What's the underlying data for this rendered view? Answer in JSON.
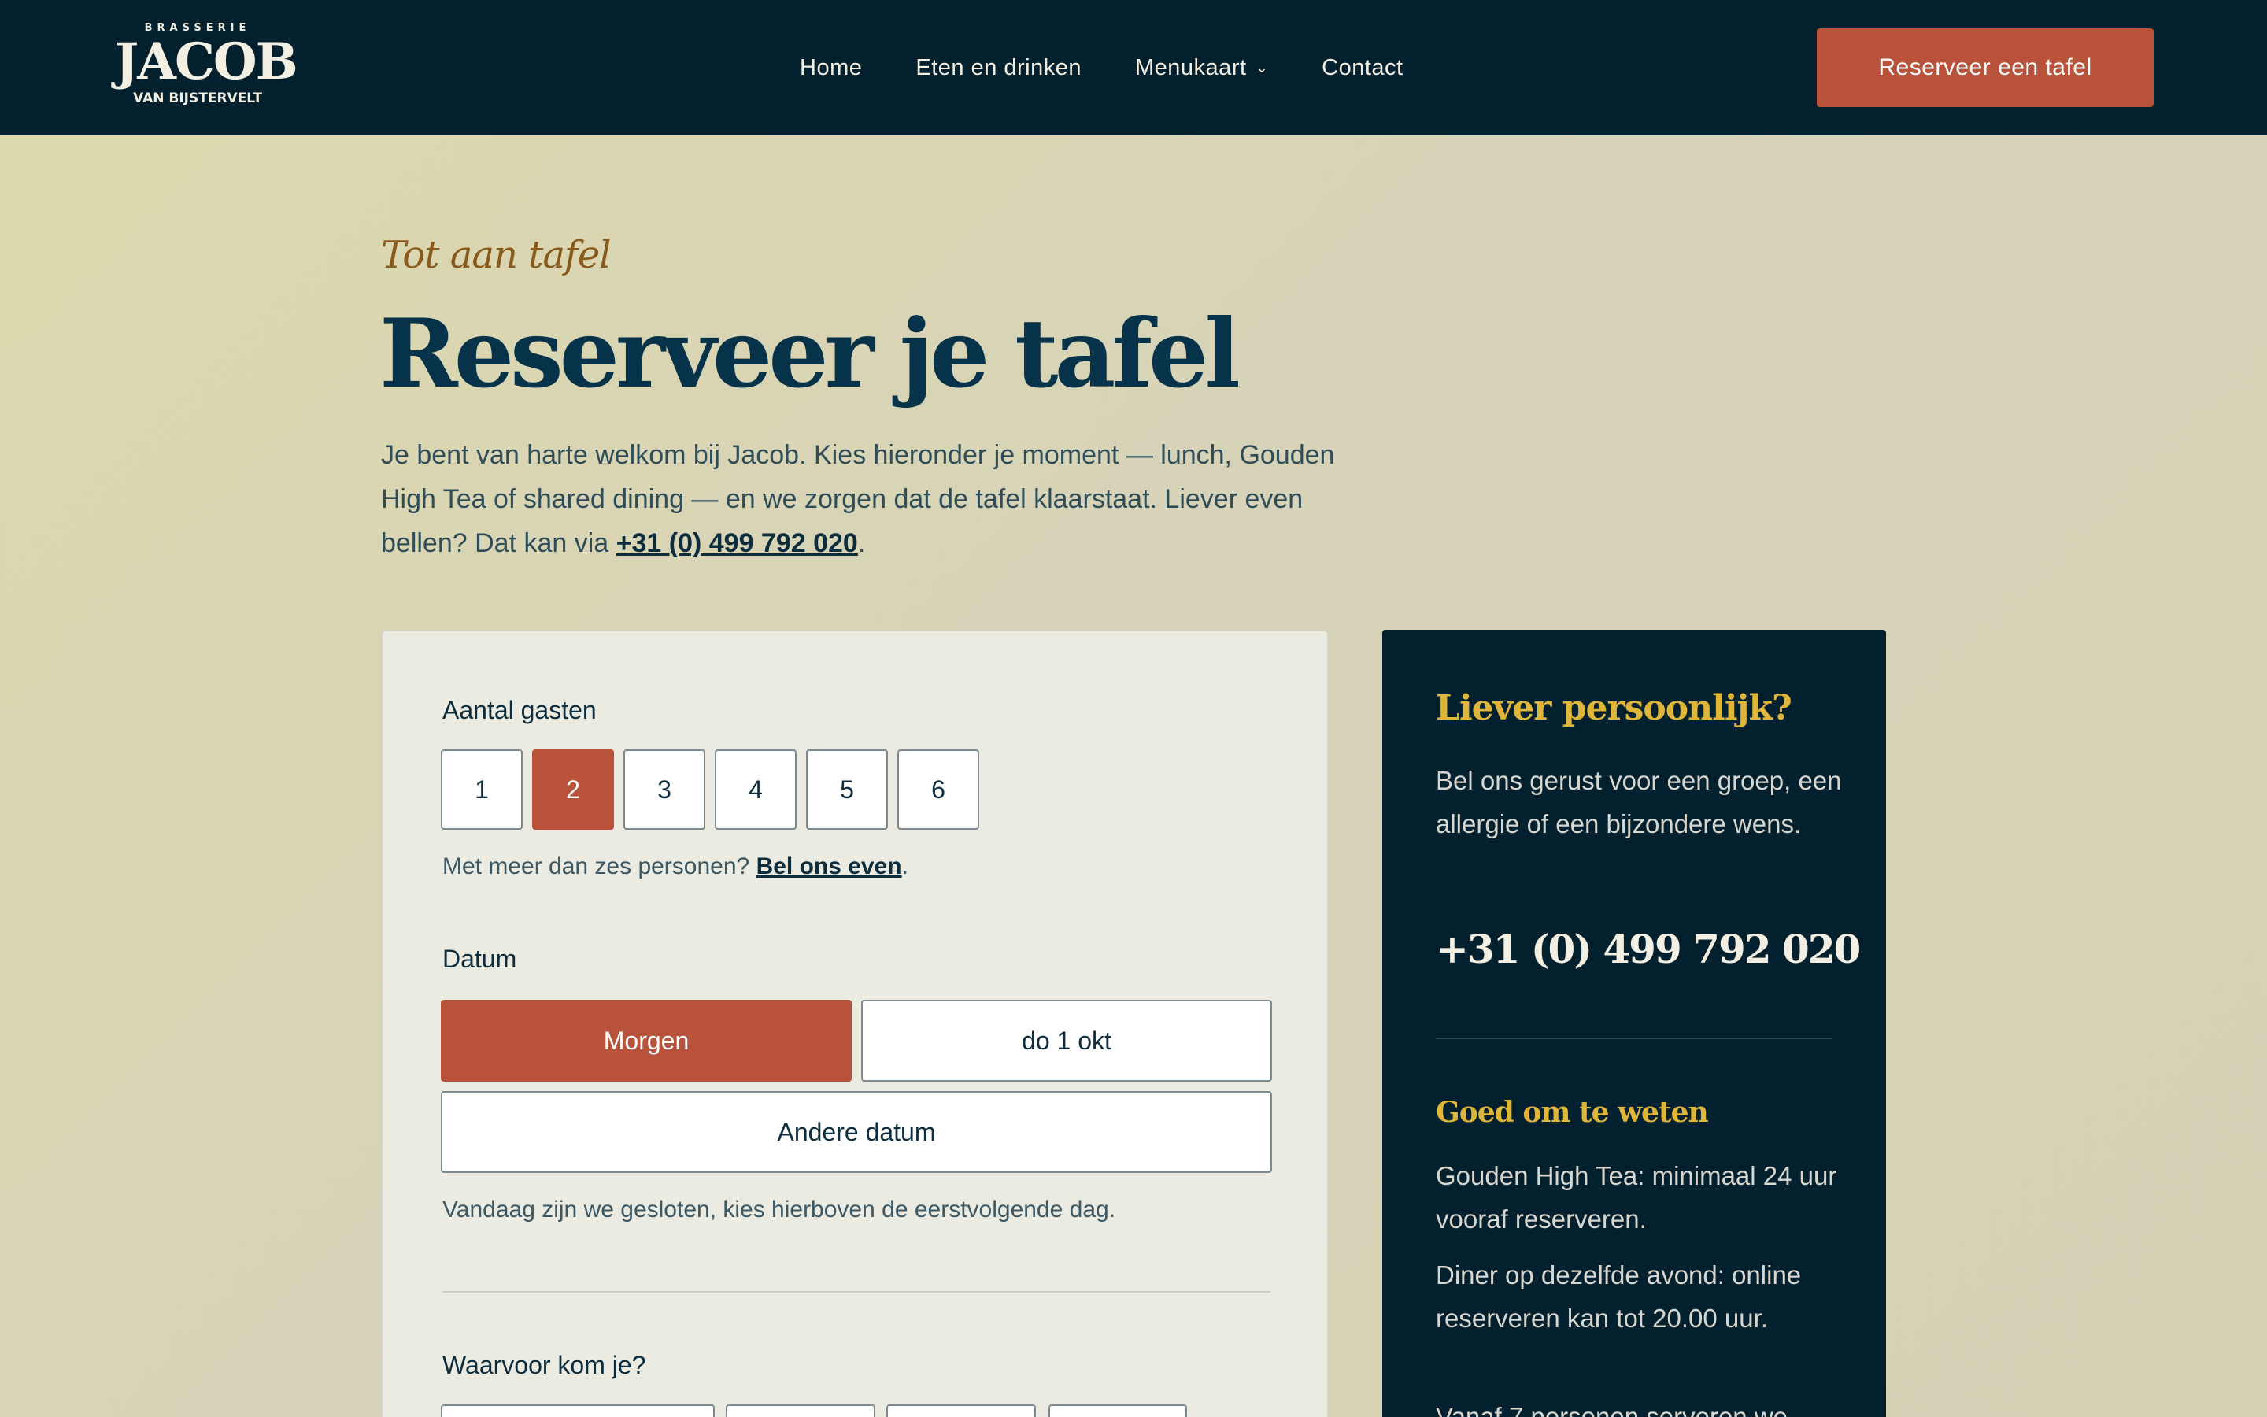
{
  "nav": {
    "logo": {
      "top": "BRASSERIE",
      "main": "JACOB",
      "bottom": "VAN BIJSTERVELT"
    },
    "links": [
      "Home",
      "Eten en drinken",
      "Menukaart",
      "Contact"
    ],
    "cta": "Reserveer een tafel"
  },
  "hero": {
    "eyebrow": "Tot aan tafel",
    "title": "Reserveer je tafel",
    "intro_text": "Je bent van harte welkom bij Jacob. Kies hieronder je moment — lunch, Gouden High Tea of shared dining — en we zorgen dat de tafel klaarstaat. Liever even bellen? Dat kan via ",
    "phone": "+31 (0) 499 792 020",
    "intro_end": "."
  },
  "form": {
    "guests_label": "Aantal gasten",
    "guest_options": [
      "1",
      "2",
      "3",
      "4",
      "5",
      "6"
    ],
    "guests_selected": "2",
    "guests_note_text": "Met meer dan zes personen? ",
    "guests_note_link": "Bel ons even",
    "guests_note_end": ".",
    "date_label": "Datum",
    "date_options": {
      "tomorrow": "Morgen",
      "next": "do 1 okt",
      "other": "Andere datum"
    },
    "date_selected": "Morgen",
    "date_note": "Vandaag zijn we gesloten, kies hierboven de eerstvolgende dag.",
    "purpose_label": "Waarvoor kom je?"
  },
  "sidebar": {
    "personal_title": "Liever persoonlijk?",
    "personal_text": "Bel ons gerust voor een groep, een allergie of een bijzondere wens.",
    "phone": "+31 (0) 499 792 020",
    "good_title": "Goed om te weten",
    "tip1": "Gouden High Tea: minimaal 24 uur vooraf reserveren.",
    "tip2": "Diner op dezelfde avond: online reserveren kan tot 20.00 uur.",
    "tip3": "Vanaf 7 personen serveren we"
  },
  "colors": {
    "navy": "#03202e",
    "accent": "#b9523b",
    "gold": "#e0b63a",
    "background": "#d7d3b8"
  }
}
